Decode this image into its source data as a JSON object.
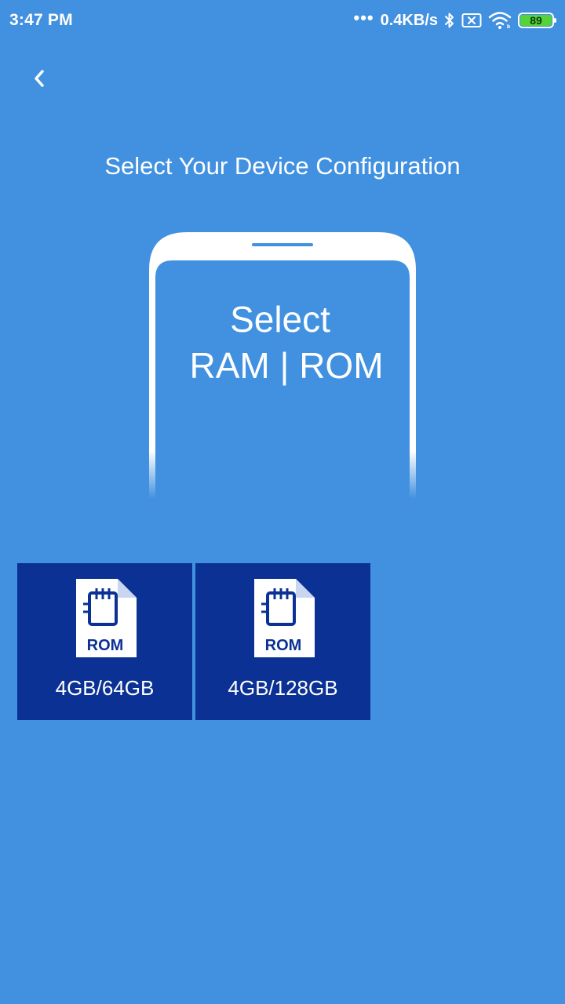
{
  "status_bar": {
    "time": "3:47 PM",
    "dots": "•••",
    "network_speed": "0.4KB/s",
    "battery_level": "89",
    "icons": [
      "bluetooth-icon",
      "sim-x-icon",
      "wifi-icon",
      "battery-icon"
    ],
    "battery_color": "#55d33b"
  },
  "header": {
    "back_icon": "chevron-left-icon",
    "title": "Select Your Device Configuration"
  },
  "illustration": {
    "line1": "Select",
    "line2": "RAM | ROM"
  },
  "options": [
    {
      "icon": "rom-file-icon",
      "icon_text": "ROM",
      "label": "4GB/64GB"
    },
    {
      "icon": "rom-file-icon",
      "icon_text": "ROM",
      "label": "4GB/128GB"
    }
  ],
  "colors": {
    "background": "#4191e0",
    "card": "#0b3194",
    "text": "#ffffff"
  }
}
